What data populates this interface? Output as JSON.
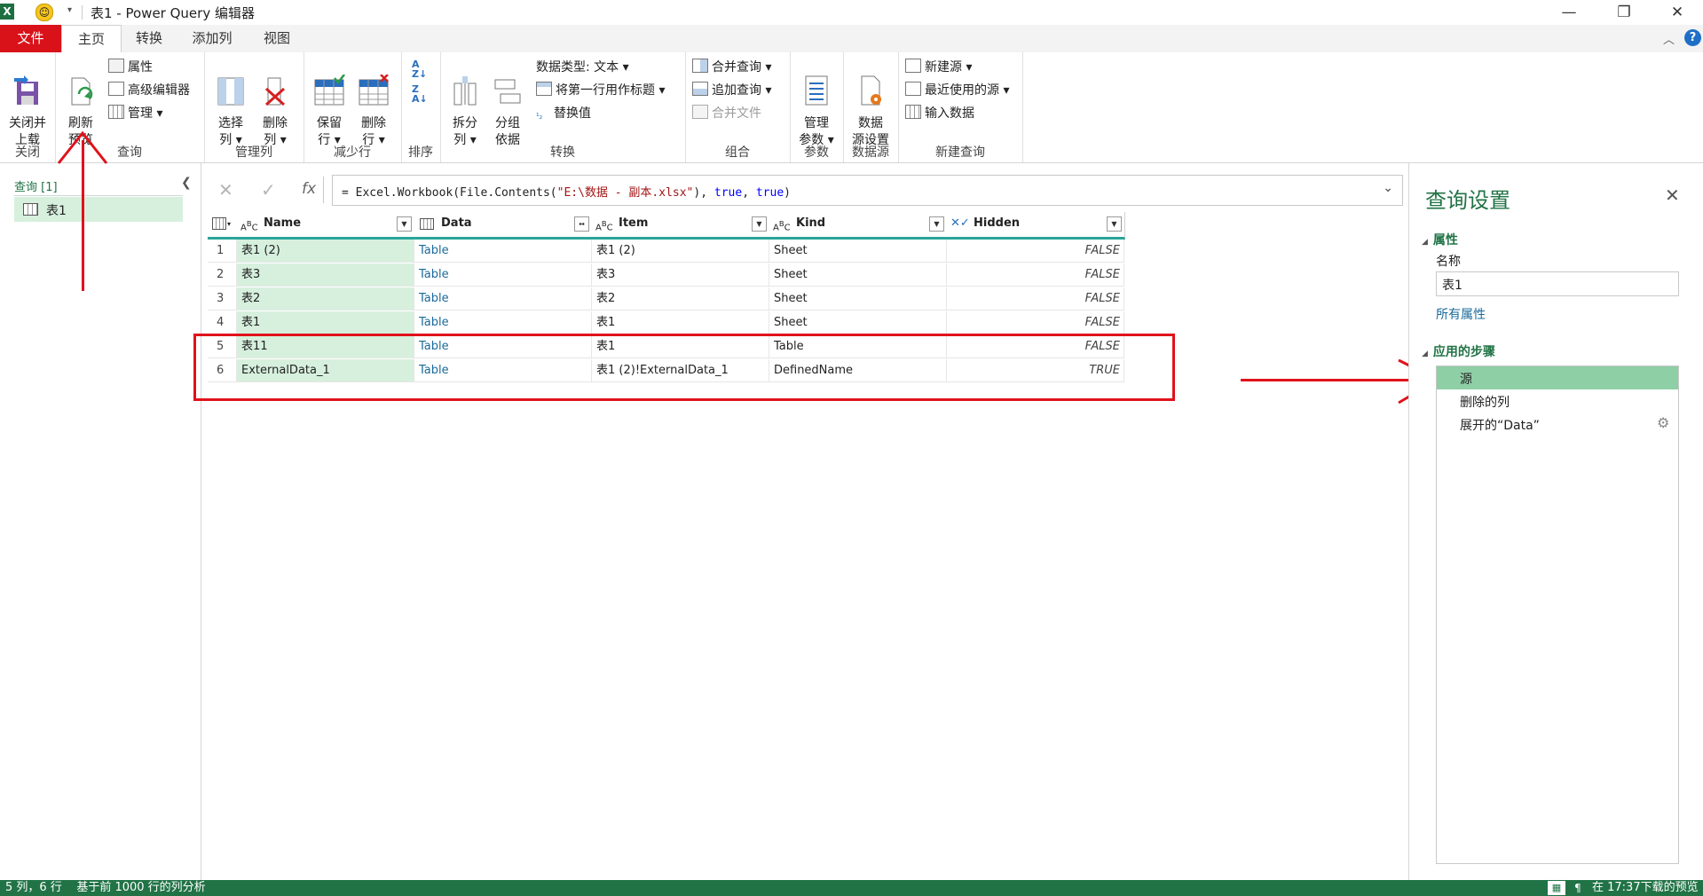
{
  "window": {
    "title": "表1 - Power Query 编辑器"
  },
  "tabs": [
    {
      "label": "文件"
    },
    {
      "label": "主页"
    },
    {
      "label": "转换"
    },
    {
      "label": "添加列"
    },
    {
      "label": "视图"
    }
  ],
  "ribbon": {
    "close": {
      "btn": "关闭并\n上载",
      "group": "关闭"
    },
    "query": {
      "refresh": "刷新\n预览",
      "properties": "属性",
      "advanced_editor": "高级编辑器",
      "manage": "管理",
      "group": "查询"
    },
    "manage_cols": {
      "choose": "选择\n列",
      "remove": "删除\n列",
      "group": "管理列"
    },
    "reduce_rows": {
      "keep": "保留\n行",
      "remove": "删除\n行",
      "group": "减少行"
    },
    "sort": {
      "group": "排序"
    },
    "transform": {
      "split": "拆分\n列",
      "groupby": "分组\n依据",
      "datatype": "数据类型: 文本",
      "first_row": "将第一行用作标题",
      "replace": "替换值",
      "group": "转换"
    },
    "combine": {
      "merge": "合并查询",
      "append": "追加查询",
      "files": "合并文件",
      "group": "组合"
    },
    "params": {
      "manage": "管理\n参数",
      "group": "参数"
    },
    "datasource": {
      "settings": "数据\n源设置",
      "group": "数据源"
    },
    "newquery": {
      "new_source": "新建源",
      "recent": "最近使用的源",
      "enter": "输入数据",
      "group": "新建查询"
    }
  },
  "left": {
    "header": "查询 [1]",
    "items": [
      {
        "label": "表1"
      }
    ]
  },
  "formula": {
    "prefix": "=",
    "text_pre": "Excel.Workbook(File.Contents(",
    "str": "\"E:\\数据 - 副本.xlsx\"",
    "text_mid": "), ",
    "kw1": "true",
    "sep": ", ",
    "kw2": "true",
    "text_post": ")",
    "fx": "fx"
  },
  "grid": {
    "columns": [
      {
        "type": "ABC",
        "name": "Name"
      },
      {
        "type": "table",
        "name": "Data"
      },
      {
        "type": "ABC",
        "name": "Item"
      },
      {
        "type": "ABC",
        "name": "Kind"
      },
      {
        "type": "check",
        "name": "Hidden"
      }
    ],
    "rows": [
      {
        "n": "1",
        "name": "表1 (2)",
        "data": "Table",
        "item": "表1 (2)",
        "kind": "Sheet",
        "hidden": "FALSE"
      },
      {
        "n": "2",
        "name": "表3",
        "data": "Table",
        "item": "表3",
        "kind": "Sheet",
        "hidden": "FALSE"
      },
      {
        "n": "3",
        "name": "表2",
        "data": "Table",
        "item": "表2",
        "kind": "Sheet",
        "hidden": "FALSE"
      },
      {
        "n": "4",
        "name": "表1",
        "data": "Table",
        "item": "表1",
        "kind": "Sheet",
        "hidden": "FALSE"
      },
      {
        "n": "5",
        "name": "表11",
        "data": "Table",
        "item": "表1",
        "kind": "Table",
        "hidden": "FALSE"
      },
      {
        "n": "6",
        "name": "ExternalData_1",
        "data": "Table",
        "item": "表1 (2)!ExternalData_1",
        "kind": "DefinedName",
        "hidden": "TRUE"
      }
    ]
  },
  "settings": {
    "title": "查询设置",
    "props_header": "属性",
    "name_label": "名称",
    "name_value": "表1",
    "all_props": "所有属性",
    "steps_header": "应用的步骤",
    "steps": [
      {
        "label": "源"
      },
      {
        "label": "删除的列"
      },
      {
        "label": "展开的“Data”"
      }
    ]
  },
  "status": {
    "left": "5 列，6 行    基于前 1000 行的列分析",
    "right": "在 17:37下载的预览"
  },
  "colors": {
    "accent": "#217346",
    "file_tab": "#d9121a",
    "annotation": "#e0121b",
    "selected": "#d6f0dd"
  }
}
